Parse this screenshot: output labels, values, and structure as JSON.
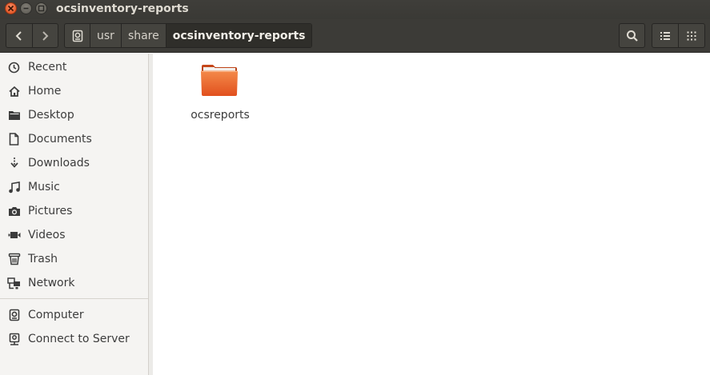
{
  "window": {
    "title": "ocsinventory-reports"
  },
  "toolbar": {
    "breadcrumbs": [
      "usr",
      "share",
      "ocsinventory-reports"
    ]
  },
  "sidebar": {
    "places": [
      {
        "label": "Recent",
        "icon": "clock-icon"
      },
      {
        "label": "Home",
        "icon": "home-icon"
      },
      {
        "label": "Desktop",
        "icon": "folder-icon"
      },
      {
        "label": "Documents",
        "icon": "document-icon"
      },
      {
        "label": "Downloads",
        "icon": "download-icon"
      },
      {
        "label": "Music",
        "icon": "music-icon"
      },
      {
        "label": "Pictures",
        "icon": "camera-icon"
      },
      {
        "label": "Videos",
        "icon": "video-icon"
      },
      {
        "label": "Trash",
        "icon": "trash-icon"
      },
      {
        "label": "Network",
        "icon": "network-icon"
      }
    ],
    "devices": [
      {
        "label": "Computer",
        "icon": "drive-icon"
      },
      {
        "label": "Connect to Server",
        "icon": "server-icon"
      }
    ]
  },
  "content": {
    "items": [
      {
        "name": "ocsreports",
        "type": "folder"
      }
    ]
  },
  "colors": {
    "folder": "#e9622b",
    "close_button": "#df4b16",
    "titlebar": "#3c3b37"
  }
}
